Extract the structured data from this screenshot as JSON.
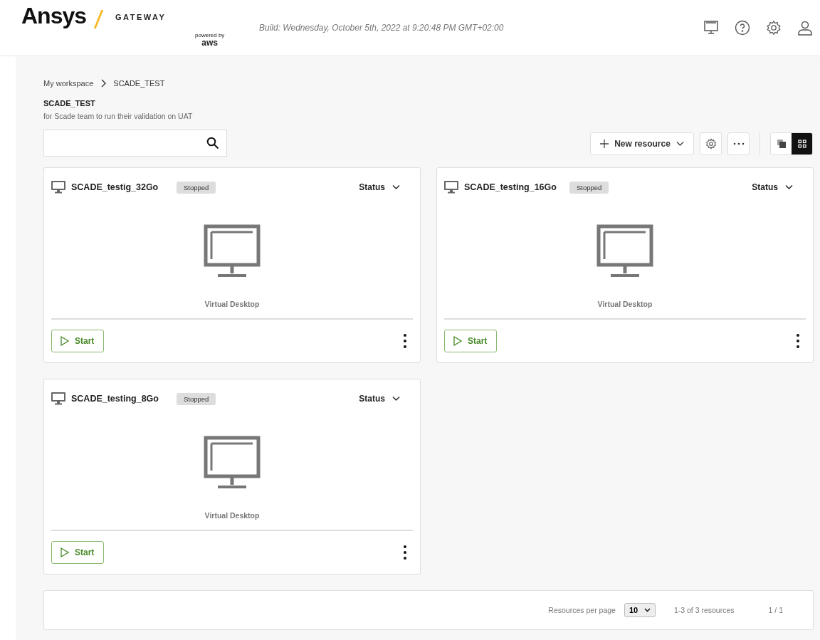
{
  "header": {
    "brand": "Ansys",
    "product": "GATEWAY",
    "powered_by": "powered by",
    "aws": "aws",
    "build": "Build: Wednesday, October 5th, 2022 at 9:20:48 PM GMT+02:00"
  },
  "breadcrumb": [
    "My workspace",
    "SCADE_TEST"
  ],
  "workspace": {
    "title": "SCADE_TEST",
    "description": "for Scade team to run their validation on UAT"
  },
  "toolbar": {
    "new_resource": "New resource",
    "views": [
      {
        "kind": "list",
        "selected": false
      },
      {
        "kind": "grid",
        "selected": true
      }
    ]
  },
  "resources": [
    {
      "name": "SCADE_testig_32Go",
      "status": "Stopped",
      "status_menu": "Status",
      "type": "Virtual Desktop",
      "action": "Start"
    },
    {
      "name": "SCADE_testing_16Go",
      "status": "Stopped",
      "status_menu": "Status",
      "type": "Virtual Desktop",
      "action": "Start"
    },
    {
      "name": "SCADE_testing_8Go",
      "status": "Stopped",
      "status_menu": "Status",
      "type": "Virtual Desktop",
      "action": "Start"
    }
  ],
  "pagination": {
    "per_page_label": "Resources per page",
    "per_page": "10",
    "range": "1-3 of 3 resources",
    "page": "1 / 1"
  }
}
